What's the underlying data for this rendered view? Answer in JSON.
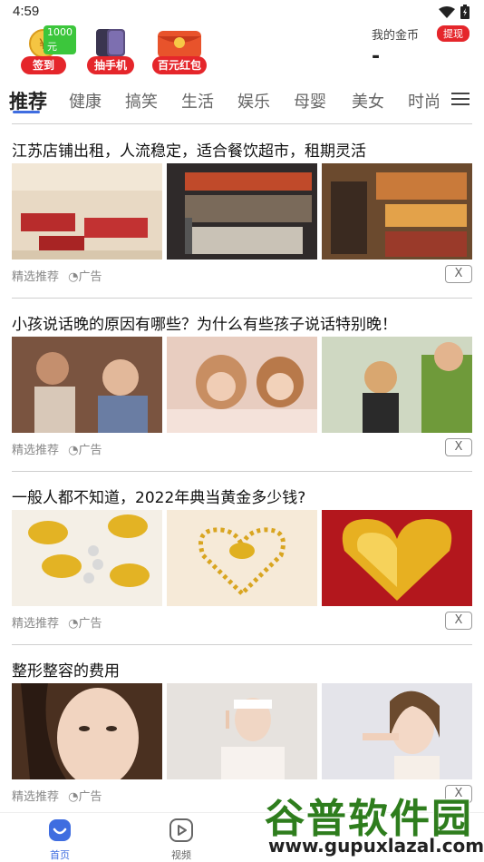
{
  "status_bar": {
    "time": "4:59"
  },
  "promo": {
    "checkin_label": "签到",
    "checkin_badge": "1000元",
    "lottery_label": "抽手机",
    "redpacket_label": "百元红包",
    "coins_title": "我的金币",
    "withdraw_label": "提现",
    "coins_value": "-"
  },
  "tabs": [
    {
      "label": "推荐"
    },
    {
      "label": "健康"
    },
    {
      "label": "搞笑"
    },
    {
      "label": "生活"
    },
    {
      "label": "娱乐"
    },
    {
      "label": "母婴"
    },
    {
      "label": "美女"
    },
    {
      "label": "时尚"
    }
  ],
  "feed": [
    {
      "title": "江苏店铺出租，人流稳定，适合餐饮超市，租期灵活",
      "source": "精选推荐",
      "ad_label": "广告",
      "close": "X"
    },
    {
      "title": "小孩说话晚的原因有哪些？为什么有些孩子说话特别晚！",
      "source": "精选推荐",
      "ad_label": "广告",
      "close": "X"
    },
    {
      "title": "一般人都不知道，2022年典当黄金多少钱?",
      "source": "精选推荐",
      "ad_label": "广告",
      "close": "X"
    },
    {
      "title": "整形整容的费用",
      "source": "精选推荐",
      "ad_label": "广告",
      "close": "X"
    }
  ],
  "bottom_nav": [
    {
      "label": "首页",
      "icon": "home-icon"
    },
    {
      "label": "视频",
      "icon": "video-icon"
    }
  ],
  "watermark": {
    "text": "谷普软件园",
    "url": "www.gupuxlazal.com"
  },
  "colors": {
    "accent": "#3f6de0",
    "red": "#e5262b",
    "green": "#3cc63c"
  }
}
